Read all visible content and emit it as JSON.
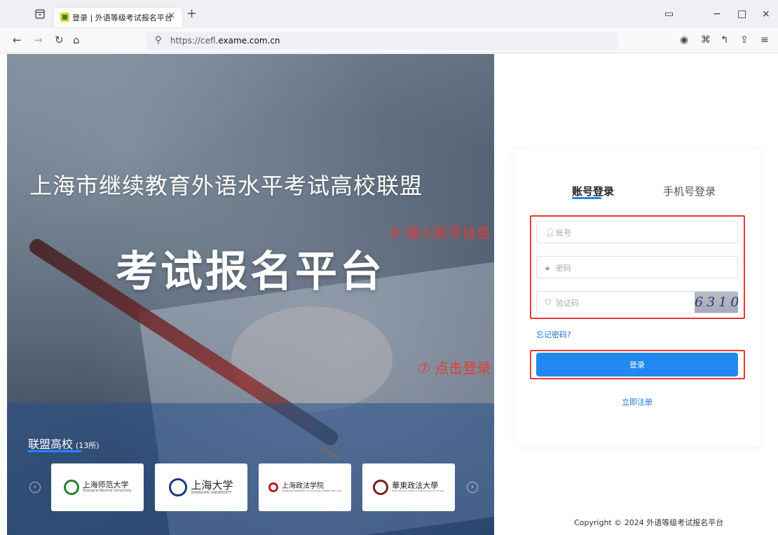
{
  "browser": {
    "tab_title": "登录 | 外语等级考试报名平台",
    "tab_close": "×",
    "new_tab": "+",
    "url_prefix": "https://cefl.",
    "url_domain": "exame.com.cn",
    "window_controls": [
      "▭",
      "−",
      "□",
      "×"
    ]
  },
  "hero": {
    "title_line1": "上海市继续教育外语水平考试高校联盟",
    "title_line2": "考试报名平台",
    "alliance_title": "联盟高校",
    "alliance_count": "(13所)",
    "universities": [
      {
        "name": "上海师范大学",
        "sub": "Shanghai Normal University",
        "color": "#2e7d32"
      },
      {
        "name": "上海大学",
        "sub": "SHANGHAI UNIVERSITY",
        "color": "#1a3a7a"
      },
      {
        "name": "上海政法学院",
        "sub": "SHANGHAI UNIVERSITY OF POLITICAL SCIENCE AND LAW",
        "color": "#b71c1c"
      },
      {
        "name": "華東政法大學",
        "sub": "East China University of Political Science and Law",
        "color": "#7a1f1f"
      }
    ]
  },
  "annotations": {
    "step6": "⑥ 输入账号信息",
    "step7": "⑦ 点击登录"
  },
  "login": {
    "tab_account": "账号登录",
    "tab_phone": "手机号登录",
    "account_placeholder": "账号",
    "password_placeholder": "密码",
    "captcha_placeholder": "验证码",
    "captcha_text": "6310",
    "forgot_password": "忘记密码?",
    "login_button": "登录",
    "register_link": "立即注册"
  },
  "footer": {
    "copyright": "Copyright © 2024 外语等级考试报名平台"
  }
}
